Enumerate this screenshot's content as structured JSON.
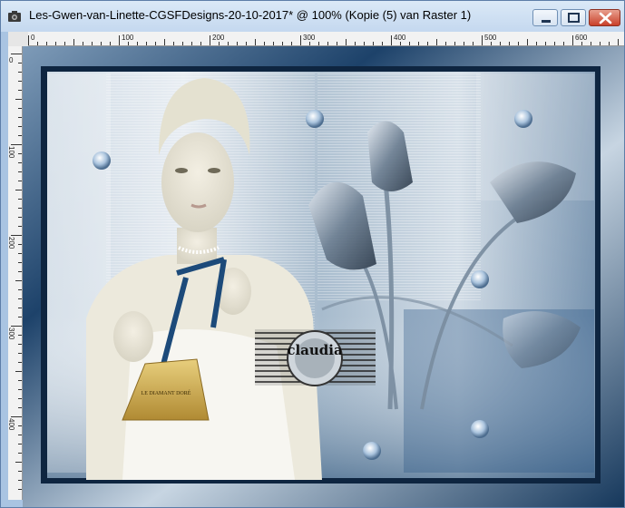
{
  "window": {
    "title": "Les-Gwen-van-Linette-CGSFDesigns-20-10-2017* @ 100% (Kopie (5) van Raster 1)"
  },
  "ruler_top": {
    "labels": [
      "0",
      "100",
      "200",
      "300",
      "400",
      "500",
      "600"
    ]
  },
  "ruler_left": {
    "labels": [
      "0",
      "100",
      "200",
      "300",
      "400"
    ]
  },
  "canvas_art": {
    "product_lines": [
      "LE DIAMANT DORÉ"
    ],
    "watermark": "claudia"
  },
  "colors": {
    "title_bar": "#c4d8ef",
    "frame": "#1b3d60",
    "close_button": "#c9402a"
  }
}
